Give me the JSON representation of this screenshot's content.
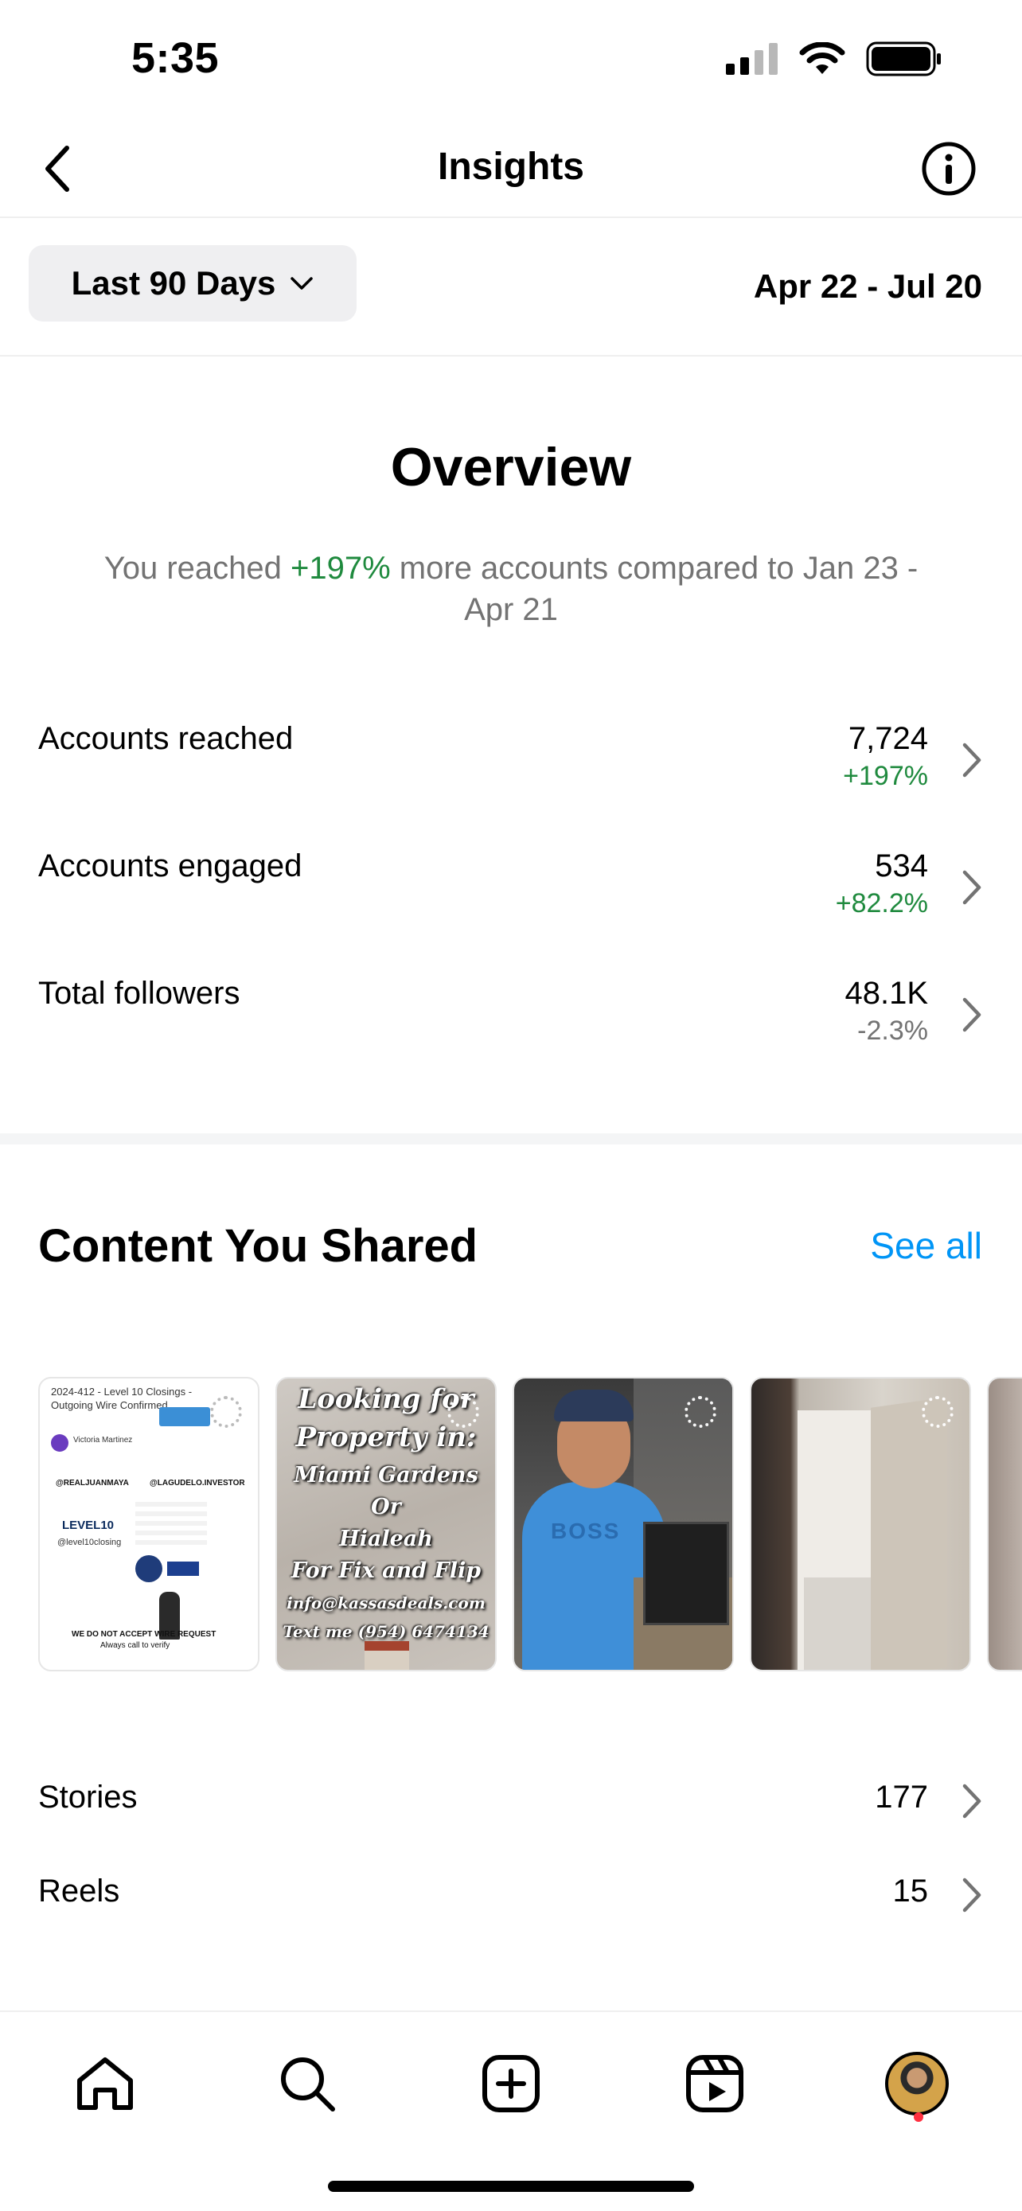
{
  "status_bar": {
    "time": "5:35",
    "icons": [
      "cellular-signal-icon",
      "wifi-icon",
      "battery-icon"
    ]
  },
  "header": {
    "title": "Insights",
    "back_icon": "chevron-left-icon",
    "info_icon": "info-icon"
  },
  "range": {
    "selector_label": "Last 90 Days",
    "selector_icon": "chevron-down-icon",
    "dates": "Apr 22 - Jul 20"
  },
  "overview": {
    "title": "Overview",
    "summary_prefix": "You reached ",
    "summary_highlight": "+197%",
    "summary_suffix": " more accounts compared to Jan 23 - Apr 21",
    "metrics": [
      {
        "label": "Accounts reached",
        "value": "7,724",
        "change": "+197%"
      },
      {
        "label": "Accounts engaged",
        "value": "534",
        "change": "+82.2%"
      },
      {
        "label": "Total followers",
        "value": "48.1K",
        "change": "-2.3%"
      }
    ]
  },
  "content": {
    "title": "Content You Shared",
    "see_all": "See all",
    "thumbnails": [
      {
        "lines": [
          "2024-412 - Level 10 Closings -",
          "Outgoing Wire Confirmed",
          "Victoria Martinez",
          "@REALJUANMAYA",
          "@LAGUDELO.INVESTOR",
          "LEVEL10",
          "@level10closing",
          "WE DO NOT ACCEPT WIRE REQUEST",
          "Always call to verify"
        ]
      },
      {
        "lines": [
          "Looking for",
          "Property in:",
          "Miami Gardens",
          "Or",
          "Hialeah",
          "For Fix and Flip",
          "info@kassasdeals.com",
          "Text me (954) 6474134"
        ]
      },
      {
        "lines": [
          "BOSS"
        ]
      },
      {
        "lines": []
      },
      {
        "lines": []
      }
    ],
    "list": [
      {
        "label": "Stories",
        "value": "177"
      },
      {
        "label": "Reels",
        "value": "15"
      }
    ]
  },
  "bottom_nav": {
    "items": [
      "home-icon",
      "search-icon",
      "create-icon",
      "reels-icon",
      "profile-avatar"
    ]
  },
  "colors": {
    "positive": "#1f8a3e",
    "link": "#0095f6",
    "muted": "#737373",
    "notification": "#ff3040"
  }
}
